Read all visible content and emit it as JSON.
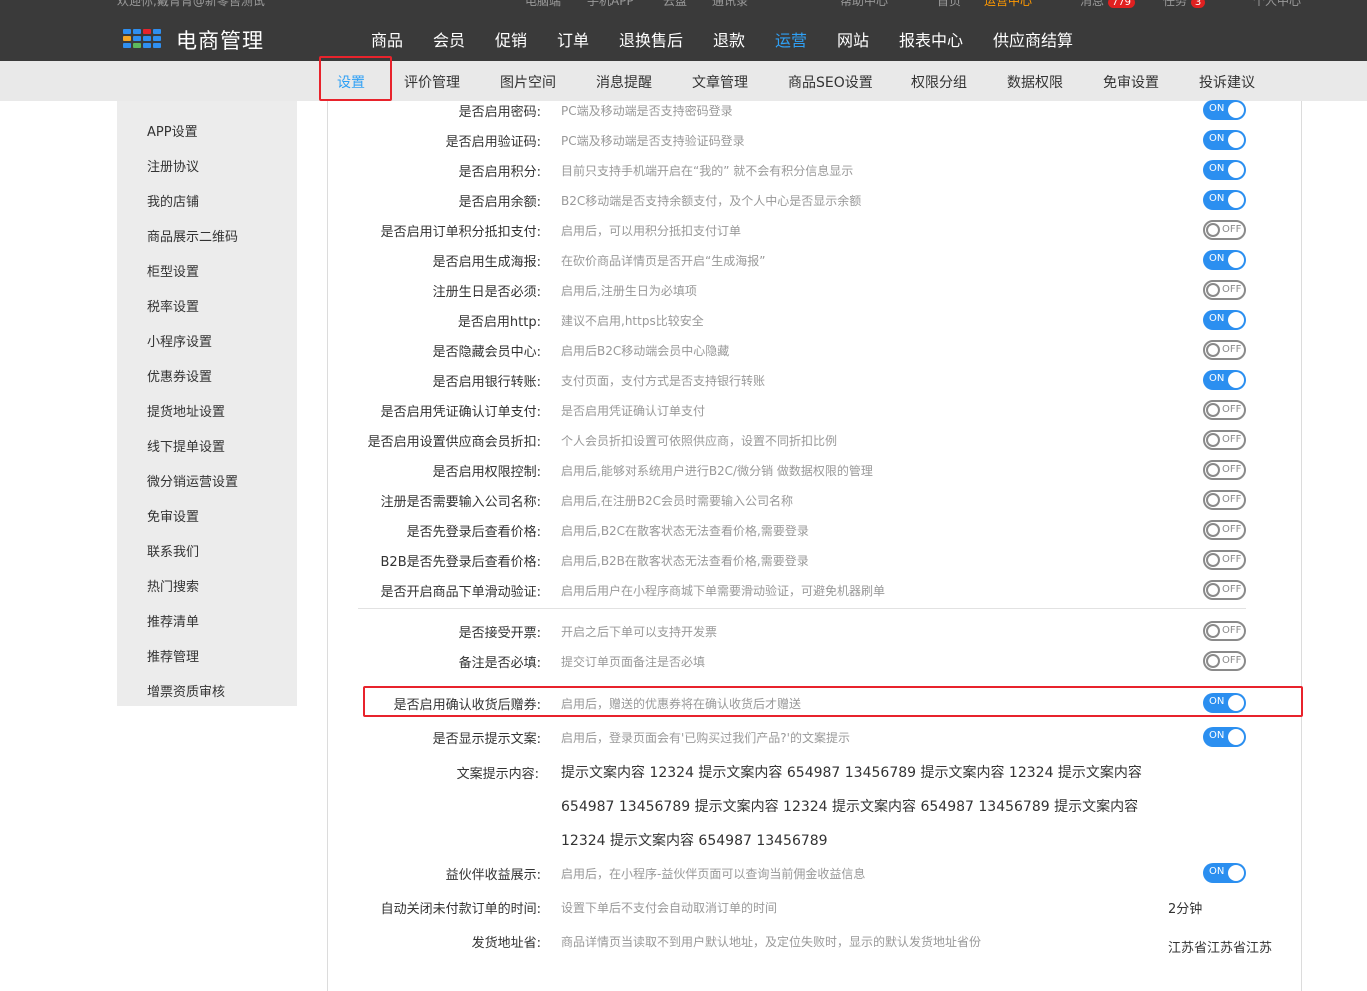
{
  "topinfo": {
    "welcome": "欢迎你,戴胥胥@新零售测试",
    "links": [
      "电脑端",
      "手机APP",
      "云盘",
      "通讯录",
      "帮助中心"
    ],
    "home": "首页",
    "ops_center": "运营中心",
    "messages": "消息",
    "messages_count": "779",
    "tasks": "任务",
    "tasks_count": "3",
    "personal": "个人中心"
  },
  "brand": {
    "name": "电商管理"
  },
  "mainnav": [
    "商品",
    "会员",
    "促销",
    "订单",
    "退换售后",
    "退款",
    "运营",
    "网站",
    "报表中心",
    "供应商结算"
  ],
  "mainnav_active": "运营",
  "subnav": [
    "设置",
    "评价管理",
    "图片空间",
    "消息提醒",
    "文章管理",
    "商品SEO设置",
    "权限分组",
    "数据权限",
    "免审设置",
    "投诉建议"
  ],
  "subnav_active": "设置",
  "sidebar": [
    "APP设置",
    "注册协议",
    "我的店铺",
    "商品展示二维码",
    "柜型设置",
    "税率设置",
    "小程序设置",
    "优惠券设置",
    "提货地址设置",
    "线下提单设置",
    "微分销运营设置",
    "免审设置",
    "联系我们",
    "热门搜索",
    "推荐清单",
    "推荐管理",
    "增票资质审核"
  ],
  "toggle_text": {
    "on": "ON",
    "off": "OFF"
  },
  "settings": [
    {
      "label": "是否启用密码:",
      "desc": "PC端及移动端是否支持密码登录",
      "state": "on"
    },
    {
      "label": "是否启用验证码:",
      "desc": "PC端及移动端是否支持验证码登录",
      "state": "on"
    },
    {
      "label": "是否启用积分:",
      "desc": "目前只支持手机端开启在“我的” 就不会有积分信息显示",
      "state": "on"
    },
    {
      "label": "是否启用余额:",
      "desc": "B2C移动端是否支持余额支付，及个人中心是否显示余额",
      "state": "on"
    },
    {
      "label": "是否启用订单积分抵扣支付:",
      "desc": "启用后，可以用积分抵扣支付订单",
      "state": "off"
    },
    {
      "label": "是否启用生成海报:",
      "desc": "在砍价商品详情页是否开启“生成海报”",
      "state": "on"
    },
    {
      "label": "注册生日是否必须:",
      "desc": "启用后,注册生日为必填项",
      "state": "off"
    },
    {
      "label": "是否启用http:",
      "desc": "建议不启用,https比较安全",
      "state": "on"
    },
    {
      "label": "是否隐藏会员中心:",
      "desc": "启用后B2C移动端会员中心隐藏",
      "state": "off"
    },
    {
      "label": "是否启用银行转账:",
      "desc": "支付页面，支付方式是否支持银行转账",
      "state": "on"
    },
    {
      "label": "是否启用凭证确认订单支付:",
      "desc": "是否启用凭证确认订单支付",
      "state": "off"
    },
    {
      "label": "是否启用设置供应商会员折扣:",
      "desc": "个人会员折扣设置可依照供应商，设置不同折扣比例",
      "state": "off"
    },
    {
      "label": "是否启用权限控制:",
      "desc": "启用后,能够对系统用户进行B2C/微分销 做数据权限的管理",
      "state": "off"
    },
    {
      "label": "注册是否需要输入公司名称:",
      "desc": "启用后,在注册B2C会员时需要输入公司名称",
      "state": "off"
    },
    {
      "label": "是否先登录后查看价格:",
      "desc": "启用后,B2C在散客状态无法查看价格,需要登录",
      "state": "off"
    },
    {
      "label": "B2B是否先登录后查看价格:",
      "desc": "启用后,B2B在散客状态无法查看价格,需要登录",
      "state": "off"
    },
    {
      "label": "是否开启商品下单滑动验证:",
      "desc": "启用后用户在小程序商城下单需要滑动验证，可避免机器刷单",
      "state": "off"
    },
    {
      "label": "是否接受开票:",
      "desc": "开启之后下单可以支持开发票",
      "state": "off"
    },
    {
      "label": "备注是否必填:",
      "desc": "提交订单页面备注是否必填",
      "state": "off"
    },
    {
      "label": "是否启用确认收货后赠券:",
      "desc": "启用后，赠送的优惠券将在确认收货后才赠送",
      "state": "on"
    },
    {
      "label": "是否显示提示文案:",
      "desc": "启用后，登录页面会有'已购买过我们产品?'的文案提示",
      "state": "on"
    },
    {
      "label": "益伙伴收益展示:",
      "desc": "启用后，在小程序-益伙伴页面可以查询当前佣金收益信息",
      "state": "on"
    },
    {
      "label": "自动关闭未付款订单的时间:",
      "desc": "设置下单后不支付会自动取消订单的时间",
      "value": "2分钟"
    },
    {
      "label": "发货地址省:",
      "desc": "商品详情页当读取不到用户默认地址，及定位失败时，显示的默认发货地址省份"
    }
  ],
  "tip_content": {
    "label": "文案提示内容:",
    "text": "提示文案内容 12324 提示文案内容 654987 13456789 提示文案内容 12324 提示文案内容 654987 13456789 提示文案内容 12324 提示文案内容 654987 13456789 提示文案内容 12324 提示文案内容 654987 13456789"
  },
  "ship_province_value": "江苏省江苏省江苏",
  "colors": {
    "accent": "#2fa0f5",
    "toggle_on": "#2b8ff0",
    "highlight": "#e8232c",
    "topbar": "#3a3a3a"
  }
}
